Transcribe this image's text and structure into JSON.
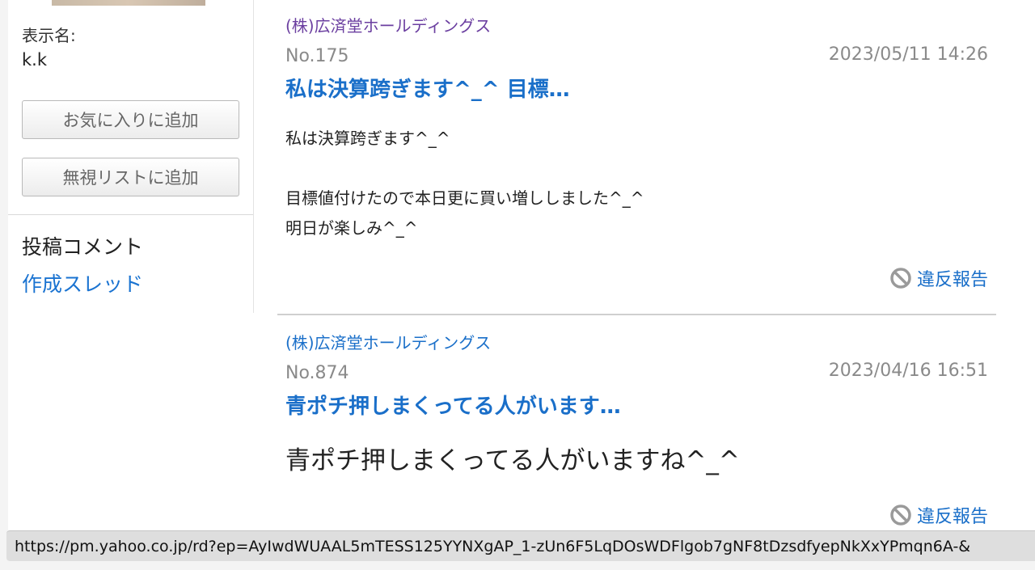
{
  "sidebar": {
    "display_name_label": "表示名:",
    "display_name_value": "k.k",
    "favorite_button": "お気に入りに追加",
    "ignore_button": "無視リストに追加",
    "posted_comments": "投稿コメント",
    "created_threads": "作成スレッド"
  },
  "posts": [
    {
      "board": "(株)広済堂ホールディングス",
      "no": "No.175",
      "date": "2023/05/11 14:26",
      "title": "私は決算跨ぎます^_^ 目標…",
      "body": "私は決算跨ぎます^_^\n\n目標値付けたので本日更に買い増ししました^_^\n明日が楽しみ^_^",
      "report": "違反報告"
    },
    {
      "board": "(株)広済堂ホールディングス",
      "no": "No.874",
      "date": "2023/04/16 16:51",
      "title": "青ポチ押しまくってる人がいます…",
      "body": "青ポチ押しまくってる人がいますね^_^",
      "report": "違反報告"
    }
  ],
  "statusbar": {
    "url": "https://pm.yahoo.co.jp/rd?ep=AyIwdWUAAL5mTESS125YYNXgAP_1-zUn6F5LqDOsWDFlgob7gNF8tDzsdfyepNkXxYPmqn6A-&"
  },
  "icons": {
    "report": "prohibited-icon"
  },
  "colors": {
    "link": "#1a6fc9",
    "visited": "#6b3fa0",
    "meta": "#8a8a8a"
  }
}
